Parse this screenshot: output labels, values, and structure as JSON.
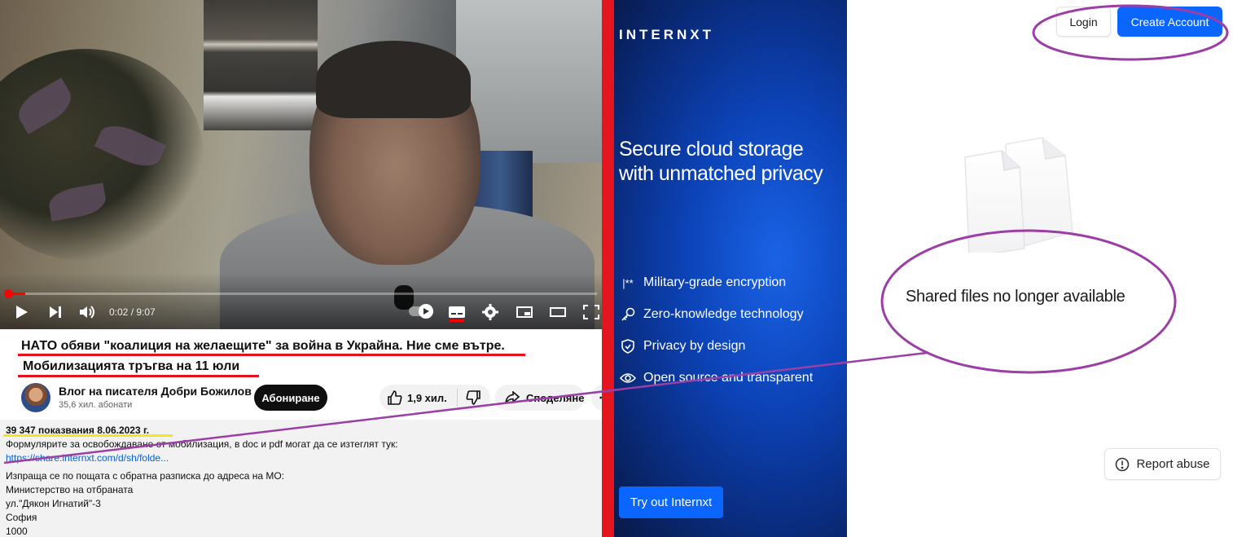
{
  "youtube": {
    "video": {
      "time_current": "0:02",
      "time_total": "9:07",
      "time_display": "0:02 / 9:07",
      "progress_fraction": 0.004
    },
    "title_line1": "НАТО обяви \"коалиция на желаещите\" за война в Украйна. Ние сме вътре.",
    "title_line2": "Мобилизацията тръгва на 11 юли",
    "channel": {
      "name": "Влог на писателя Добри Божилов",
      "subscribers": "35,6 хил. абонати",
      "subscribe_label": "Абониране"
    },
    "actions": {
      "likes": "1,9 хил.",
      "share_label": "Споделяне"
    },
    "description": {
      "stats": "39 347 показвания  8.06.2023 г.",
      "lines": [
        "Формулярите за освобождаване от мобилизация, в doc и pdf могат да се изтеглят тук:",
        "https://share.internxt.com/d/sh/folde...",
        "Изпраща се по пощата с обратна разписка до адреса на МО:",
        "Министерство на отбраната",
        "ул.\"Дякон Игнатий\"-3",
        "София",
        "1000"
      ]
    }
  },
  "brand": {
    "logo": "INTERNXT",
    "headline": "Secure cloud storage with unmatched privacy",
    "features": [
      {
        "icon": "password-icon",
        "glyph": "|**",
        "label": "Military-grade encryption"
      },
      {
        "icon": "key-icon",
        "label": "Zero-knowledge technology"
      },
      {
        "icon": "shield-icon",
        "label": "Privacy by design"
      },
      {
        "icon": "eye-icon",
        "label": "Open source and transparent"
      }
    ],
    "cta_label": "Try out Internxt",
    "colors": {
      "panel": "#0c43b8",
      "button": "#0b66ff"
    }
  },
  "share_page": {
    "login_label": "Login",
    "create_account_label": "Create Account",
    "empty_message": "Shared files no longer available",
    "report_label": "Report abuse",
    "colors": {
      "primary": "#0b66ff"
    }
  },
  "annotations": {
    "colors": {
      "red": "#e8101c",
      "yellow": "#f5e51f",
      "purple": "#9b3fa6"
    }
  }
}
